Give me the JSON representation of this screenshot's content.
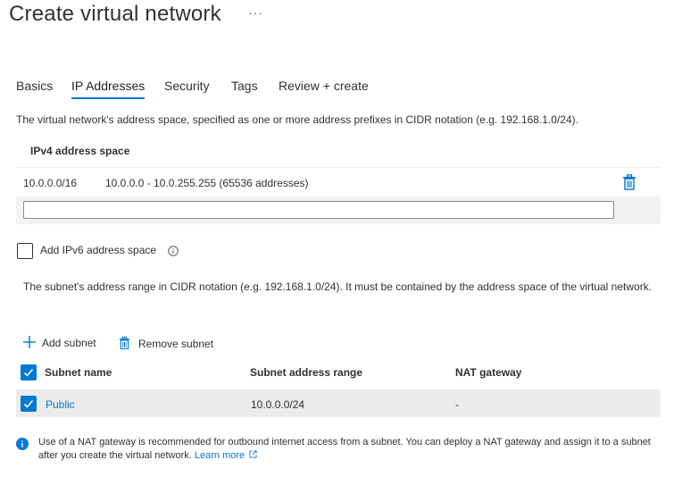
{
  "header": {
    "title": "Create virtual network",
    "more_label": "···"
  },
  "tabs": [
    {
      "label": "Basics",
      "active": false
    },
    {
      "label": "IP Addresses",
      "active": true
    },
    {
      "label": "Security",
      "active": false
    },
    {
      "label": "Tags",
      "active": false
    },
    {
      "label": "Review + create",
      "active": false
    }
  ],
  "address_space": {
    "description": "The virtual network's address space, specified as one or more address prefixes in CIDR notation (e.g. 192.168.1.0/24).",
    "header": "IPv4 address space",
    "rows": [
      {
        "prefix": "10.0.0.0/16",
        "range": "10.0.0.0 - 10.0.255.255 (65536 addresses)"
      }
    ],
    "new_prefix_value": "",
    "new_prefix_placeholder": ""
  },
  "ipv6": {
    "label": "Add IPv6 address space",
    "checked": false
  },
  "subnets": {
    "description": "The subnet's address range in CIDR notation (e.g. 192.168.1.0/24). It must be contained by the address space of the virtual network.",
    "add_label": "Add subnet",
    "remove_label": "Remove subnet",
    "columns": [
      "Subnet name",
      "Subnet address range",
      "NAT gateway"
    ],
    "rows": [
      {
        "name": "Public",
        "range": "10.0.0.0/24",
        "nat": "-",
        "checked": true
      }
    ]
  },
  "footer": {
    "text": "Use of a NAT gateway is recommended for outbound internet access from a subnet. You can deploy a NAT gateway and assign it to a subnet after you create the virtual network.",
    "link": "Learn more"
  },
  "colors": {
    "accent": "#0078d4",
    "row_bg": "#f3f2f1",
    "selected_row_bg": "#edebe9",
    "text": "#323130"
  }
}
